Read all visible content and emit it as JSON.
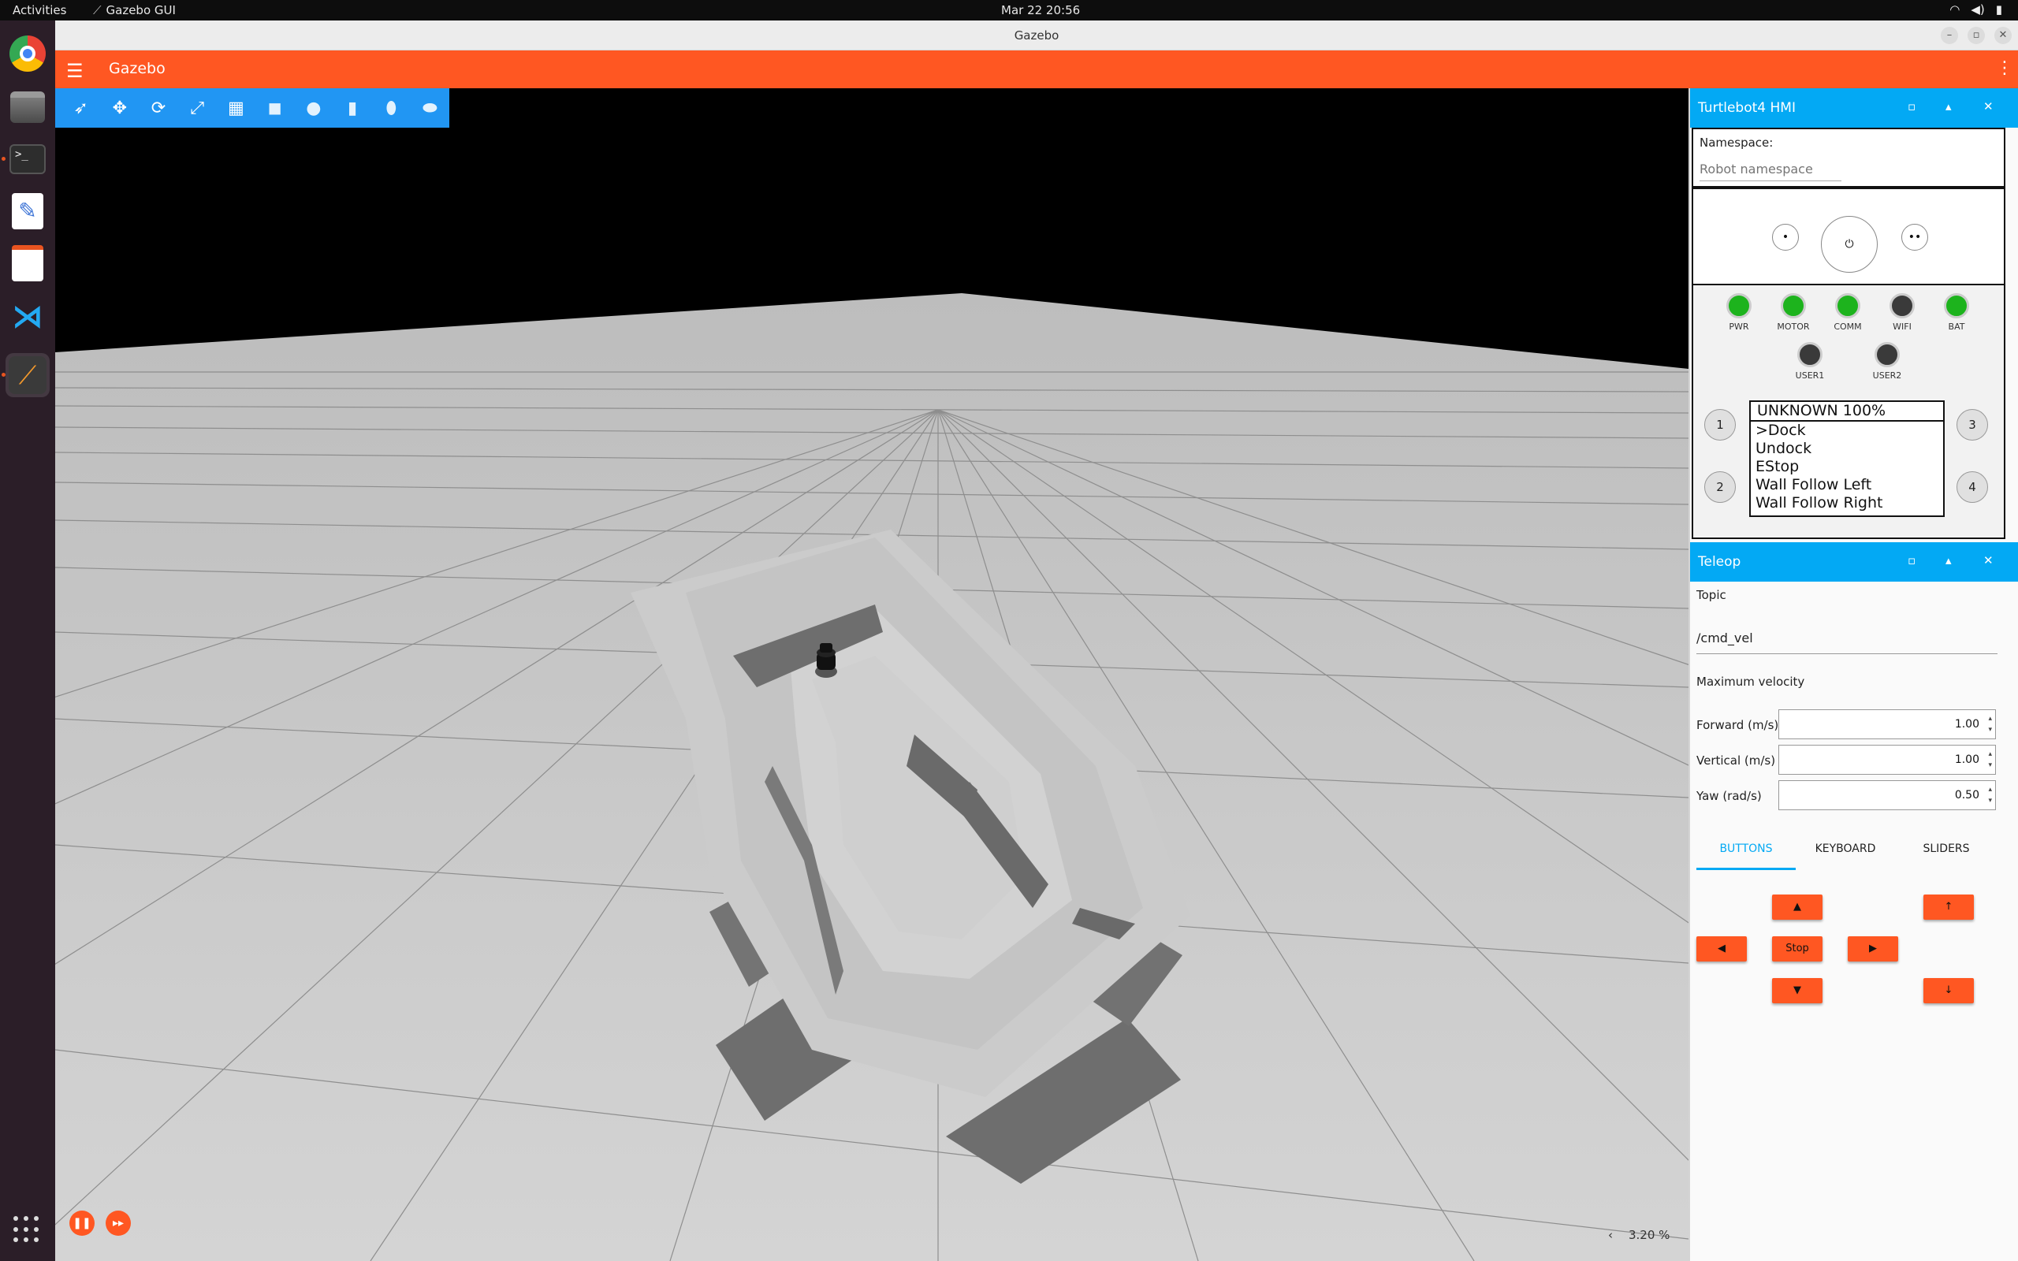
{
  "system": {
    "activities": "Activities",
    "app_name": "Gazebo GUI",
    "clock": "Mar 22  20:56"
  },
  "window": {
    "title": "Gazebo"
  },
  "header": {
    "title": "Gazebo"
  },
  "viewport": {
    "rtf": "3.20 %",
    "background": "#000000",
    "ground_color": "#cfcfcf"
  },
  "hmi": {
    "title": "Turtlebot4 HMI",
    "namespace_label": "Namespace:",
    "namespace_placeholder": "Robot namespace",
    "buttons": {
      "left": "•",
      "power": "⏻",
      "right": "••"
    },
    "leds": [
      {
        "label": "PWR",
        "state": "on"
      },
      {
        "label": "MOTOR",
        "state": "on"
      },
      {
        "label": "COMM",
        "state": "on"
      },
      {
        "label": "WIFI",
        "state": "off"
      },
      {
        "label": "BAT",
        "state": "on"
      },
      {
        "label": "USER1",
        "state": "off"
      },
      {
        "label": "USER2",
        "state": "off"
      }
    ],
    "num_buttons": [
      "1",
      "2",
      "3",
      "4"
    ],
    "menu": {
      "header": "UNKNOWN 100%",
      "items": [
        ">Dock",
        "Undock",
        "EStop",
        "Wall Follow Left",
        "Wall Follow Right"
      ]
    }
  },
  "teleop": {
    "title": "Teleop",
    "topic_label": "Topic",
    "topic_value": "/cmd_vel",
    "max_velocity_label": "Maximum velocity",
    "forward_label": "Forward (m/s)",
    "forward_value": "1.00",
    "vertical_label": "Vertical (m/s)",
    "vertical_value": "1.00",
    "yaw_label": "Yaw (rad/s)",
    "yaw_value": "0.50",
    "tabs": [
      "BUTTONS",
      "KEYBOARD",
      "SLIDERS"
    ],
    "active_tab": "BUTTONS",
    "controls": {
      "forward": "▲",
      "backward": "▼",
      "left": "◀",
      "right": "▶",
      "stop": "Stop",
      "up": "↑",
      "down": "↓"
    }
  },
  "colors": {
    "accent_orange": "#ff5722",
    "panel_blue": "#03a9f4",
    "toolbar_blue": "#2196f3",
    "led_on": "#1db31d",
    "led_off": "#3a3a3a"
  }
}
